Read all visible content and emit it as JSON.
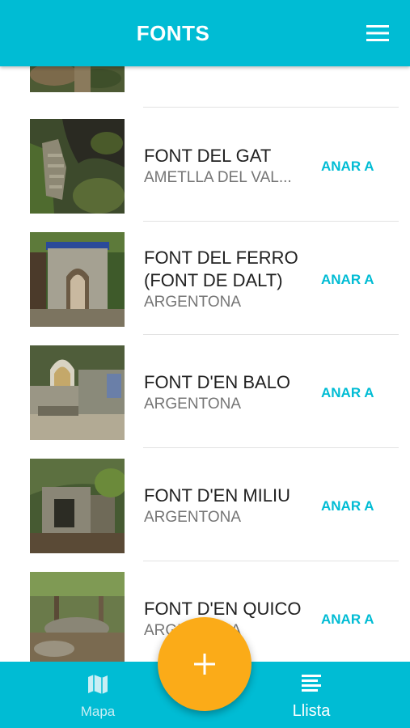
{
  "header": {
    "title": "FONTS",
    "menu_icon": "menu-icon"
  },
  "fonts": [
    {
      "name": "",
      "place": "",
      "action": ""
    },
    {
      "name": "FONT DEL GAT",
      "place": "AMETLLA DEL VAL...",
      "action": "ANAR A"
    },
    {
      "name": "FONT DEL FERRO (FONT DE DALT)",
      "place": "ARGENTONA",
      "action": "ANAR A"
    },
    {
      "name": "FONT D'EN BALO",
      "place": "ARGENTONA",
      "action": "ANAR A"
    },
    {
      "name": "FONT D'EN MILIU",
      "place": "ARGENTONA",
      "action": "ANAR A"
    },
    {
      "name": "FONT D'EN QUICO",
      "place": "ARGENTONA",
      "action": "ANAR A"
    }
  ],
  "fab": {
    "icon": "plus-icon"
  },
  "bottom_nav": {
    "map": {
      "label": "Mapa",
      "icon": "map-icon"
    },
    "list": {
      "label": "Llista",
      "icon": "list-icon"
    }
  },
  "colors": {
    "primary": "#00bcd4",
    "accent": "#fbab18",
    "text": "#212121",
    "secondary_text": "#757575"
  }
}
